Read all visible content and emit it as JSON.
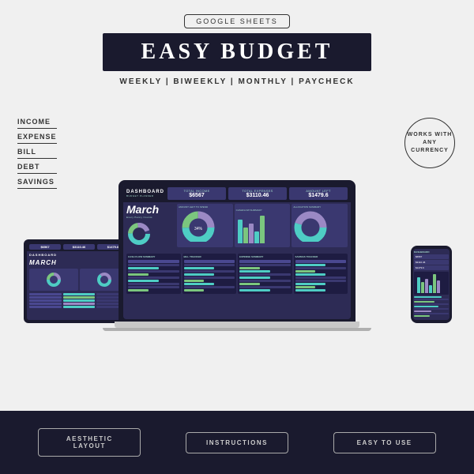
{
  "badge": {
    "google_sheets": "Google Sheets"
  },
  "hero": {
    "title": "Easy Budget",
    "subtitle": "Weekly | Biweekly | Monthly | Paycheck"
  },
  "left_labels": {
    "items": [
      "Income",
      "Expense",
      "Bill",
      "Debt",
      "Savings"
    ]
  },
  "right_label": {
    "line1": "Works With",
    "line2": "Any",
    "line3": "Currency"
  },
  "spreadsheet": {
    "dashboard_label": "Dashboard",
    "budget_planner": "Budget Planner",
    "month": "March",
    "tagline": "Every Penny Counts",
    "total_income_label": "Total Income",
    "total_income_value": "$6567",
    "total_expenses_label": "Total Expenses",
    "total_expenses_value": "$3110.46",
    "amount_left_label": "Amount Left",
    "amount_left_value": "$1479.6",
    "cashflow_label": "Cashflow Summary",
    "allocation_label": "Allocation Summary"
  },
  "bottom_badges": {
    "aesthetic": "Aesthetic Layout",
    "instructions": "Instructions",
    "easy": "Easy To Use"
  },
  "colors": {
    "dark_bg": "#1a1a2e",
    "purple_bg": "#2d2b55",
    "teal": "#4ecdc4",
    "green": "#7bc67e",
    "purple_light": "#9b89c4",
    "accent_purple": "#6c5fc7"
  }
}
